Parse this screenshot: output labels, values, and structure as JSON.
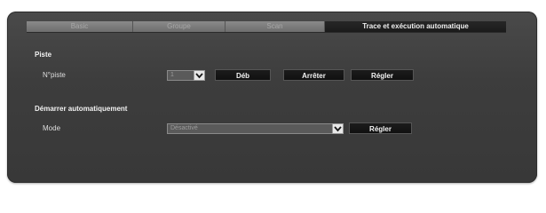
{
  "tabs": [
    {
      "label": "Basic",
      "active": false
    },
    {
      "label": "Groupe",
      "active": false
    },
    {
      "label": "Scan",
      "active": false
    },
    {
      "label": "Trace et exécution automatique",
      "active": true
    }
  ],
  "trace": {
    "title": "Piste",
    "number_label": "N°piste",
    "number_value": "1",
    "start_button": "Déb",
    "stop_button": "Arrêter",
    "set_button": "Régler"
  },
  "auto_run": {
    "title": "Démarrer automatiquement",
    "mode_label": "Mode",
    "mode_value": "Désactivé",
    "set_button": "Régler"
  },
  "colors": {
    "panel": "#3d3d3d",
    "active_tab": "#1b1b1b",
    "inactive_tab": "#7a7a7a",
    "button": "#151515"
  }
}
